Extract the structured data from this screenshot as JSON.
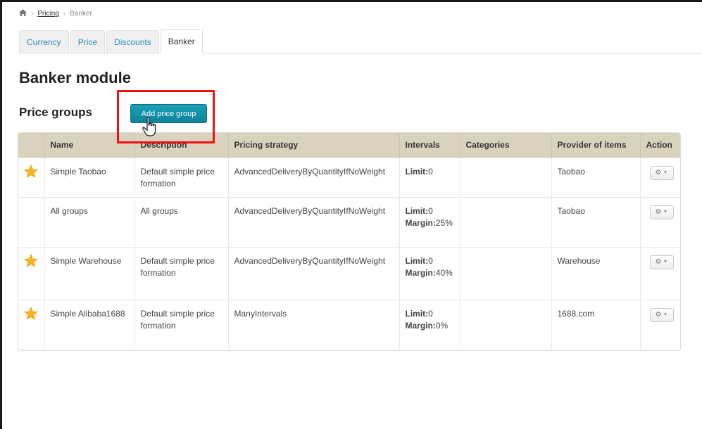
{
  "breadcrumb": {
    "home_icon": "home-icon",
    "pricing": "Pricing",
    "current": "Banker"
  },
  "tabs": [
    {
      "label": "Currency",
      "active": false
    },
    {
      "label": "Price",
      "active": false
    },
    {
      "label": "Discounts",
      "active": false
    },
    {
      "label": "Banker",
      "active": true
    }
  ],
  "page_title": "Banker module",
  "section_title": "Price groups",
  "add_button_label": "Add price group",
  "highlight_color": "#ee1111",
  "accent_color": "#1397ad",
  "table": {
    "columns": [
      "",
      "Name",
      "Description",
      "Pricing strategy",
      "Intervals",
      "Categories",
      "Provider of items",
      "Action"
    ],
    "rows": [
      {
        "starred": true,
        "name": "Simple Taobao",
        "description": "Default simple price formation",
        "strategy": "AdvancedDeliveryByQuantityIfNoWeight",
        "limit_label": "Limit:",
        "limit_value": "0",
        "margin_label": "",
        "margin_value": "",
        "categories": "",
        "provider": "Taobao"
      },
      {
        "starred": false,
        "name": "All groups",
        "description": "All groups",
        "strategy": "AdvancedDeliveryByQuantityIfNoWeight",
        "limit_label": "Limit:",
        "limit_value": "0",
        "margin_label": "Margin:",
        "margin_value": "25%",
        "categories": "",
        "provider": "Taobao"
      },
      {
        "starred": true,
        "name": "Simple Warehouse",
        "description": "Default simple price formation",
        "strategy": "AdvancedDeliveryByQuantityIfNoWeight",
        "limit_label": "Limit:",
        "limit_value": "0",
        "margin_label": "Margin:",
        "margin_value": "40%",
        "categories": "",
        "provider": "Warehouse"
      },
      {
        "starred": true,
        "name": "Simple Alibaba1688",
        "description": "Default simple price formation",
        "strategy": "ManyIntervals",
        "limit_label": "Limit:",
        "limit_value": "0",
        "margin_label": "Margin:",
        "margin_value": "0%",
        "categories": "",
        "provider": "1688.com"
      }
    ]
  }
}
